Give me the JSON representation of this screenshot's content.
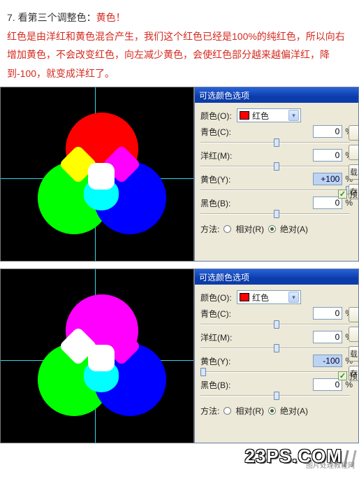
{
  "article": {
    "line1_black": "7. 看第三个调整色：",
    "line1_red": "黄色！",
    "line2": "红色是由洋红和黄色混合产生，我们这个红色已经是100%的纯红色，所以向右增加黄色，不会改变红色，向左减少黄色，会使红色部分越来越偏洋红，降到-100，就变成洋红了。"
  },
  "dialog": {
    "title": "可选颜色选项",
    "color_label": "颜色(O):",
    "color_value": "红色",
    "sliders": {
      "cyan": {
        "label": "青色(C):",
        "value": "0",
        "percent": "%",
        "pos_pct": 50
      },
      "magenta": {
        "label": "洋红(M):",
        "value": "0",
        "percent": "%",
        "pos_pct": 50
      },
      "yellow_pos": {
        "label": "黄色(Y):",
        "value": "+100",
        "percent": "%",
        "pos_pct": 100
      },
      "yellow_neg": {
        "label": "黄色(Y):",
        "value": "-100",
        "percent": "%",
        "pos_pct": 0
      },
      "black": {
        "label": "黑色(B):",
        "value": "0",
        "percent": "%",
        "pos_pct": 50
      }
    },
    "method_label": "方法:",
    "radio_rel": "相对(R)",
    "radio_abs": "绝对(A)",
    "btn_load": "载",
    "btn_save": "存",
    "chk_preview": "预"
  },
  "logo": {
    "text": "23PS.COM",
    "sub": "图片处理教程网"
  }
}
